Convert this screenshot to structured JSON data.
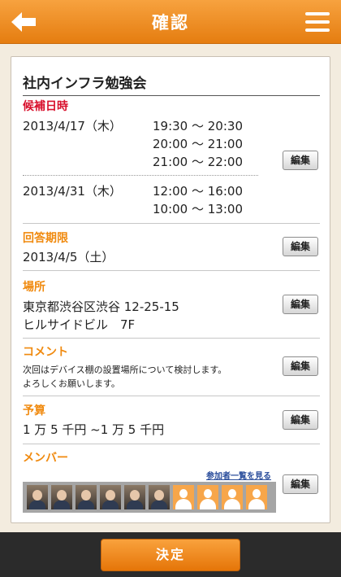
{
  "header": {
    "title": "確認",
    "back_icon": "back-arrow-icon",
    "menu_icon": "hamburger-menu-icon"
  },
  "event": {
    "title": "社内インフラ勉強会"
  },
  "candidates": {
    "label": "候補日時",
    "groups": [
      {
        "date": "2013/4/17（木）",
        "times": [
          "19:30 〜 20:30",
          "20:00 〜 21:00",
          "21:00 〜 22:00"
        ]
      },
      {
        "date": "2013/4/31（木）",
        "times": [
          "12:00 〜 16:00",
          "10:00 〜 13:00"
        ]
      }
    ]
  },
  "deadline": {
    "label": "回答期限",
    "value": "2013/4/5（土）"
  },
  "place": {
    "label": "場所",
    "line1": "東京都渋谷区渋谷 12-25-15",
    "line2": "ヒルサイドビル　7F"
  },
  "comment": {
    "label": "コメント",
    "line1": "次回はデバイス棚の設置場所について検討します。",
    "line2": "よろしくお願いします。"
  },
  "budget": {
    "label": "予算",
    "value": "1 万 5 千円 ~1 万 5 千円"
  },
  "members": {
    "label": "メンバー",
    "view_all_link": "参加者一覧を見る",
    "avatars": [
      "photo",
      "photo",
      "photo",
      "photo",
      "photo",
      "photo",
      "placeholder",
      "placeholder",
      "placeholder",
      "placeholder"
    ]
  },
  "edit_label": "編集",
  "footer": {
    "decide_label": "決定"
  },
  "colors": {
    "accent": "#f08a0f",
    "label_red": "#d8102c",
    "footer_bg": "#2b2b2b",
    "page_bg": "#f3ecdf"
  }
}
